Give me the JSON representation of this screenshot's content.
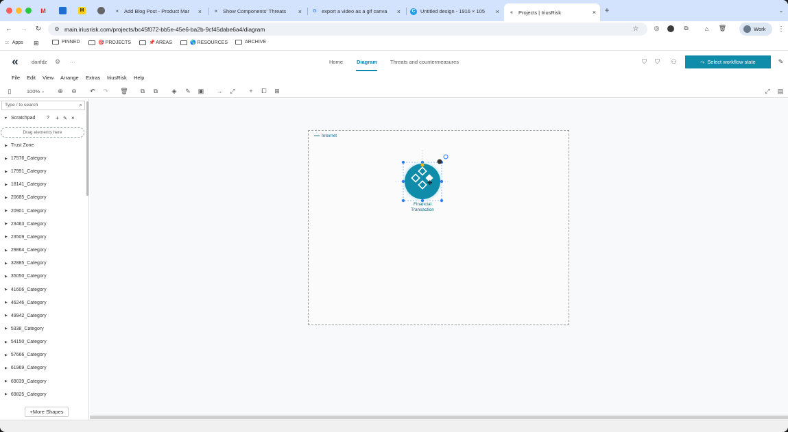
{
  "browser": {
    "tabs": [
      {
        "label": "Add Blog Post - Product Mar",
        "icon": "product-icon"
      },
      {
        "label": "Show Components' Threats",
        "icon": "iriusrisk-icon"
      },
      {
        "label": "export a video as a gif canva",
        "icon": "google-icon"
      },
      {
        "label": "Untitled design - 1916 × 105",
        "icon": "canva-icon"
      },
      {
        "label": "Projects | IriusRisk",
        "icon": "iriusrisk-icon",
        "active": true
      }
    ],
    "url": "main.iriusrisk.com/projects/bc45f072-bb5e-45e6-ba2b-9cf45dabe6a4/diagram",
    "profile_label": "Work",
    "bookmarks": [
      {
        "label": "Apps"
      },
      {
        "label": "PINNED"
      },
      {
        "label": "🎯 PROJECTS"
      },
      {
        "label": "📌 AREAS"
      },
      {
        "label": "🌎 RESOURCES"
      },
      {
        "label": "ARCHIVE"
      }
    ]
  },
  "app": {
    "project_name": "danfdz",
    "more_label": "···",
    "nav": [
      {
        "label": "Home"
      },
      {
        "label": "Diagram",
        "active": true
      },
      {
        "label": "Threats and countermeasures"
      }
    ],
    "workflow_button": "Select workflow state",
    "accent_color": "#0e8ca9"
  },
  "menu": [
    "File",
    "Edit",
    "View",
    "Arrange",
    "Extras",
    "IriusRisk",
    "Help"
  ],
  "toolbar": {
    "zoom": "100%"
  },
  "sidebar": {
    "search_placeholder": "Type / to search",
    "scratchpad_label": "Scratchpad",
    "drop_hint": "Drag elements here",
    "trust_zone": "Trust Zone",
    "categories": [
      "17576_Category",
      "17991_Category",
      "18141_Category",
      "20685_Category",
      "20901_Category",
      "23463_Category",
      "23509_Category",
      "29864_Category",
      "32885_Category",
      "35050_Category",
      "41606_Category",
      "46246_Category",
      "49942_Category",
      "5338_Category",
      "54150_Category",
      "57666_Category",
      "61969_Category",
      "69039_Category",
      "69825_Category"
    ],
    "more_shapes": "+More Shapes"
  },
  "diagram": {
    "zone_label": "Internet",
    "node_label": "Financial Transaction",
    "node_color": "#0e8ca9"
  }
}
